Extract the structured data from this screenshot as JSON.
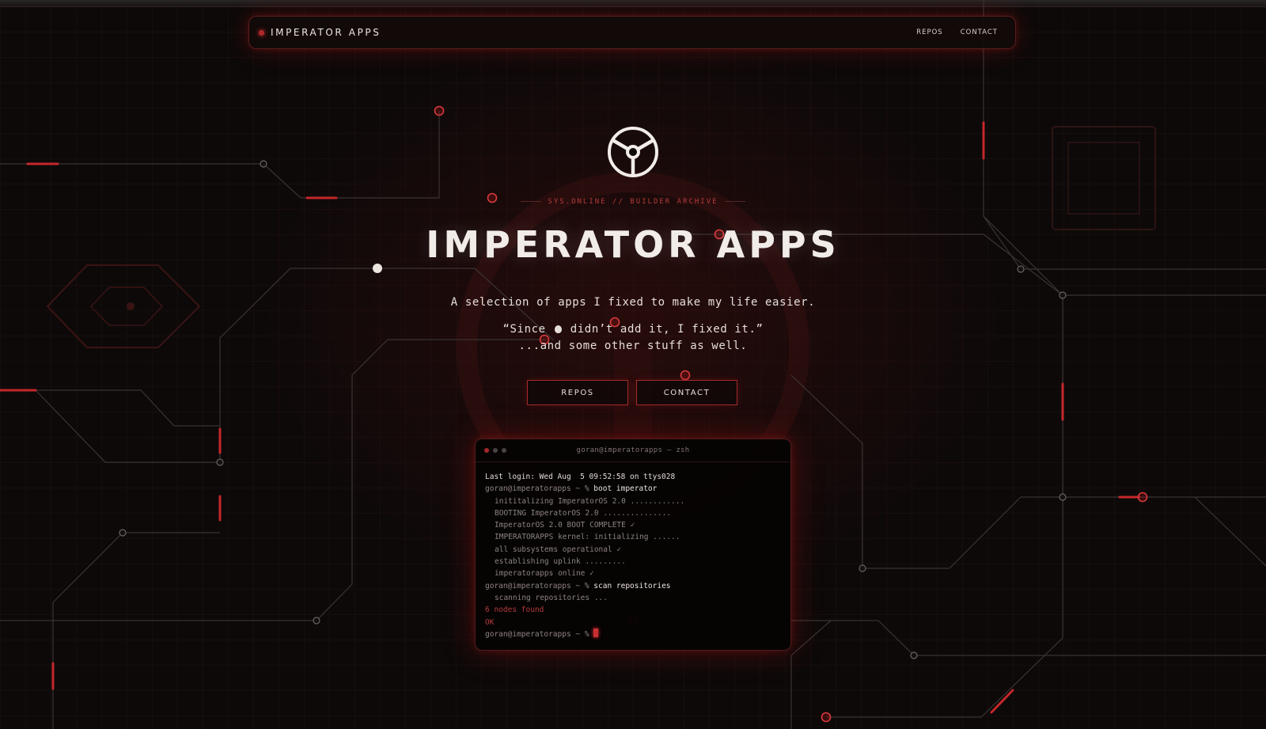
{
  "colors": {
    "background": "#0d0909",
    "accent": "#b0282a",
    "text": "#f1ece7",
    "muted": "#8c8480"
  },
  "navbar": {
    "brand": "IMPERATOR APPS",
    "links": [
      "REPOS",
      "CONTACT"
    ]
  },
  "hero": {
    "logo_icon": "tri-spoke-wheel-icon",
    "tagline": "SYS.ONLINE // BUILDER ARCHIVE",
    "title": "IMPERATOR APPS",
    "subtitle": "A selection of apps I fixed to make my life easier.",
    "quote_before": "“Since",
    "quote_icon": "apple-icon",
    "quote_after": "didn’t add it, I fixed it.”",
    "quote_line2": "...and some other stuff as well.",
    "buttons": [
      "REPOS",
      "CONTACT"
    ]
  },
  "terminal": {
    "title": "goran@imperatorapps — zsh",
    "dot_colors": [
      "#a3282a",
      "#4a4444",
      "#4a4444"
    ],
    "login": "Last login: Wed Aug  5 09:52:58 on ttys028",
    "prompt": "goran@imperatorapps ~ %",
    "cmd1": "boot imperator",
    "boot_lines": [
      "inititalizing ImperatorOS 2.0 ............",
      "BOOTING ImperatorOS 2.0 ...............",
      "ImperatorOS 2.0 BOOT COMPLETE ✓",
      "IMPERATORAPPS kernel: initializing ......",
      "all subsystems operational ✓",
      "establishing uplink .........",
      "imperatorapps online ✓"
    ],
    "cmd2": "scan repositories",
    "scan_line": "scanning repositories ...",
    "result": "6 nodes found",
    "status": "OK"
  }
}
